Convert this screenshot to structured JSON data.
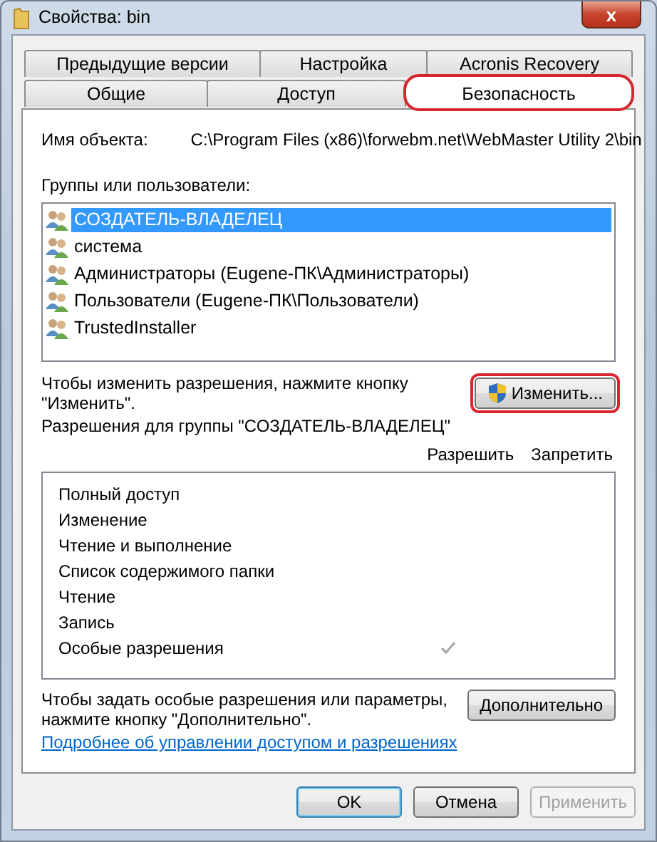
{
  "window": {
    "title": "Свойства: bin",
    "close": "x"
  },
  "tab_rows": [
    [
      {
        "label": "Предыдущие версии",
        "selected": false,
        "highlighted": false
      },
      {
        "label": "Настройка",
        "selected": false,
        "highlighted": false
      },
      {
        "label": "Acronis Recovery",
        "selected": false,
        "highlighted": false
      }
    ],
    [
      {
        "label": "Общие",
        "selected": false,
        "highlighted": false
      },
      {
        "label": "Доступ",
        "selected": false,
        "highlighted": false
      },
      {
        "label": "Безопасность",
        "selected": true,
        "highlighted": true
      }
    ]
  ],
  "object_name": {
    "label": "Имя объекта:",
    "value": "C:\\Program Files (x86)\\forwebm.net\\WebMaster Utility 2\\bin"
  },
  "groups": {
    "label": "Группы или пользователи:",
    "items": [
      {
        "name": "СОЗДАТЕЛЬ-ВЛАДЕЛЕЦ",
        "selected": true
      },
      {
        "name": "система",
        "selected": false
      },
      {
        "name": "Администраторы (Eugene-ПК\\Администраторы)",
        "selected": false
      },
      {
        "name": "Пользователи (Eugene-ПК\\Пользователи)",
        "selected": false
      },
      {
        "name": "TrustedInstaller",
        "selected": false
      }
    ]
  },
  "change_hint": "Чтобы изменить разрешения, нажмите кнопку \"Изменить\".",
  "change_button": {
    "label": "Изменить...",
    "highlighted": true
  },
  "permissions": {
    "label": "Разрешения для группы \"СОЗДАТЕЛЬ-ВЛАДЕЛЕЦ\"",
    "allow_header": "Разрешить",
    "deny_header": "Запретить",
    "rows": [
      {
        "name": "Полный доступ",
        "allow": false,
        "deny": false
      },
      {
        "name": "Изменение",
        "allow": false,
        "deny": false
      },
      {
        "name": "Чтение и выполнение",
        "allow": false,
        "deny": false
      },
      {
        "name": "Список содержимого папки",
        "allow": false,
        "deny": false
      },
      {
        "name": "Чтение",
        "allow": false,
        "deny": false
      },
      {
        "name": "Запись",
        "allow": false,
        "deny": false
      },
      {
        "name": "Особые разрешения",
        "allow": true,
        "deny": false
      }
    ]
  },
  "advanced_hint": "Чтобы задать особые разрешения или параметры, нажмите кнопку \"Дополнительно\".",
  "advanced_button": "Дополнительно",
  "help_link": "Подробнее об управлении доступом и разрешениях",
  "buttons": [
    {
      "label": "OK",
      "kind": "default",
      "disabled": false
    },
    {
      "label": "Отмена",
      "kind": "normal",
      "disabled": false
    },
    {
      "label": "Применить",
      "kind": "normal",
      "disabled": true
    }
  ]
}
